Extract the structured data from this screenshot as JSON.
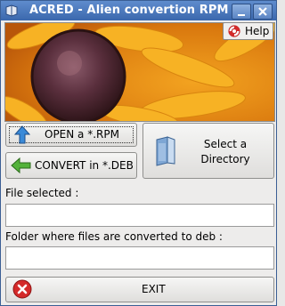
{
  "window": {
    "title": "ACRED - Alien convertion RPM"
  },
  "titlebar": {
    "icons": [
      "app-icon",
      "minimize-icon",
      "close-icon"
    ]
  },
  "banner": {
    "image": "sunflower-closeup"
  },
  "help_button": {
    "label": "Help",
    "icon": "lifebuoy-icon"
  },
  "buttons": {
    "open_rpm": {
      "label": "OPEN a *.RPM",
      "icon": "arrow-up-icon"
    },
    "convert_deb": {
      "label": "CONVERT in *.DEB",
      "icon": "arrow-left-icon"
    },
    "select_dir": {
      "label": "Select a Directory",
      "icon": "folder-icon"
    },
    "exit": {
      "label": "EXIT",
      "icon": "cancel-icon"
    }
  },
  "fields": {
    "file_selected": {
      "label": "File selected :",
      "value": ""
    },
    "folder": {
      "label": "Folder where files are converted to deb :",
      "value": ""
    }
  },
  "colors": {
    "titlebar": "#4a78bc",
    "accent_red": "#d42a2a",
    "petal_orange": "#f4a21b"
  }
}
